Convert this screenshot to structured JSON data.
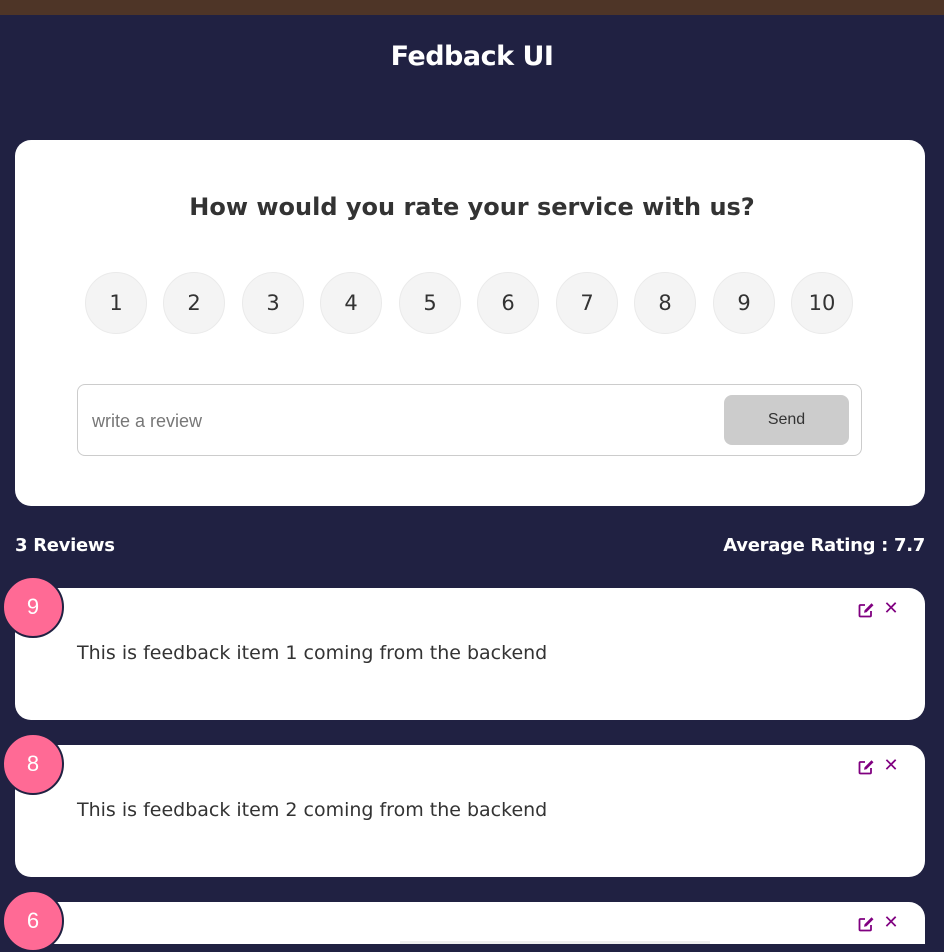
{
  "app": {
    "title": "Fedback UI"
  },
  "form": {
    "question": "How would you rate your service with us?",
    "ratings": [
      "1",
      "2",
      "3",
      "4",
      "5",
      "6",
      "7",
      "8",
      "9",
      "10"
    ],
    "input_placeholder": "write a review",
    "send_label": "Send"
  },
  "stats": {
    "count_text": "3 Reviews",
    "average_text": "Average Rating : 7.7"
  },
  "feedback": [
    {
      "rating": "9",
      "text": "This is feedback item 1 coming from the backend"
    },
    {
      "rating": "8",
      "text": "This is feedback item 2 coming from the backend"
    },
    {
      "rating": "6",
      "text": ""
    }
  ],
  "colors": {
    "background": "#202142",
    "badge": "#ff6a95",
    "action_icons": "#800080",
    "top_bar": "#4e3527"
  },
  "icons": {
    "edit": "edit-icon",
    "close": "close-icon"
  }
}
